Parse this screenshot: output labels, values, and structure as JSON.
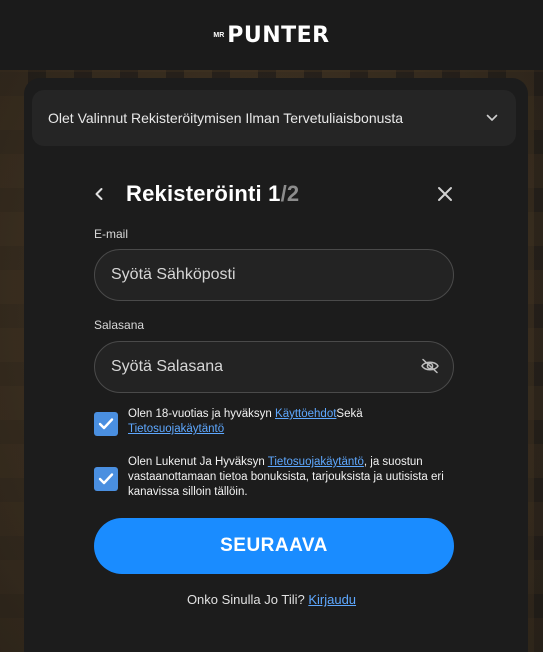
{
  "header": {
    "logo_small": "MR",
    "logo_main": "PUNTER"
  },
  "bonus": {
    "label": "Olet Valinnut Rekisteröitymisen Ilman Tervetuliaisbonusta"
  },
  "form": {
    "title": "Rekisteröinti",
    "step_current": "1",
    "step_sep": "/",
    "step_total": "2",
    "email": {
      "label": "E-mail",
      "placeholder": "Syötä Sähköposti",
      "value": ""
    },
    "password": {
      "label": "Salasana",
      "placeholder": "Syötä Salasana",
      "value": ""
    },
    "terms": {
      "checked": true,
      "text_before": "Olen 18-vuotias ja hyväksyn ",
      "link1": "Käyttöehdot",
      "text_middle": "Sekä ",
      "link2": "Tietosuojakäytäntö"
    },
    "marketing": {
      "checked": true,
      "text_before": "Olen Lukenut Ja Hyväksyn ",
      "link": "Tietosuojakäytäntö",
      "text_after": ", ja suostun vastaanottamaan tietoa bonuksista, tarjouksista ja uutisista eri kanavissa silloin tällöin."
    },
    "submit_label": "SEURAAVA",
    "login_prompt": "Onko Sinulla Jo Tili? ",
    "login_link": "Kirjaudu"
  },
  "colors": {
    "accent": "#1a8cff",
    "link": "#5ea8ff",
    "checkbox": "#4a8fe0",
    "panel": "#1c1c1c"
  },
  "icons": {
    "chevron": "chevron-down-icon",
    "back": "chevron-left-icon",
    "close": "close-icon",
    "eye": "eye-off-icon",
    "check": "check-icon"
  }
}
